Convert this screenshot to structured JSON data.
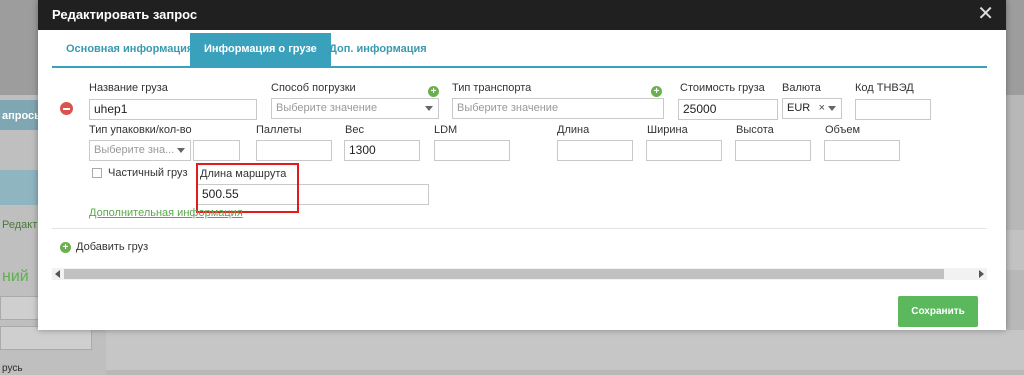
{
  "background": {
    "left_title": "апрось",
    "left_edit": "Редакти",
    "left_green": "ний",
    "left_bottom": "русь"
  },
  "modal": {
    "title": "Редактировать запрос",
    "close_symbol": "✕"
  },
  "tabs": [
    {
      "label": "Основная информация",
      "active": false
    },
    {
      "label": "Информация о грузе",
      "active": true
    },
    {
      "label": "Доп. информация",
      "active": false
    }
  ],
  "cargo": {
    "row1": {
      "name_label": "Название груза",
      "name_value": "uhep1",
      "loading_label": "Способ погрузки",
      "loading_placeholder": "Выберите значение",
      "transport_label": "Тип транспорта",
      "transport_placeholder": "Выберите значение",
      "cost_label": "Стоимость груза",
      "cost_value": "25000",
      "currency_label": "Валюта",
      "currency_value": "EUR",
      "tnved_label": "Код ТНВЭД",
      "tnved_value": ""
    },
    "row2": {
      "packaging_label": "Тип упаковки/кол-во",
      "packaging_placeholder": "Выберите зна...",
      "packaging_qty": "",
      "pallets_label": "Паллеты",
      "pallets_value": "",
      "weight_label": "Вес",
      "weight_value": "1300",
      "ldm_label": "LDM",
      "ldm_value": "",
      "length_label": "Длина",
      "length_value": "",
      "width_label": "Ширина",
      "width_value": "",
      "height_label": "Высота",
      "height_value": "",
      "volume_label": "Объем",
      "volume_value": ""
    },
    "row3": {
      "partial_label": "Частичный груз",
      "partial_checked": false,
      "route_label": "Длина маршрута",
      "route_value": "500.55"
    },
    "more_info_link": "Дополнительная информация"
  },
  "add_cargo_label": "Добавить груз",
  "save_label": "Сохранить",
  "colors": {
    "accent": "#3aa1bc",
    "save": "#5cb85c",
    "highlight": "#e01d1d",
    "remove": "#d9534f"
  }
}
